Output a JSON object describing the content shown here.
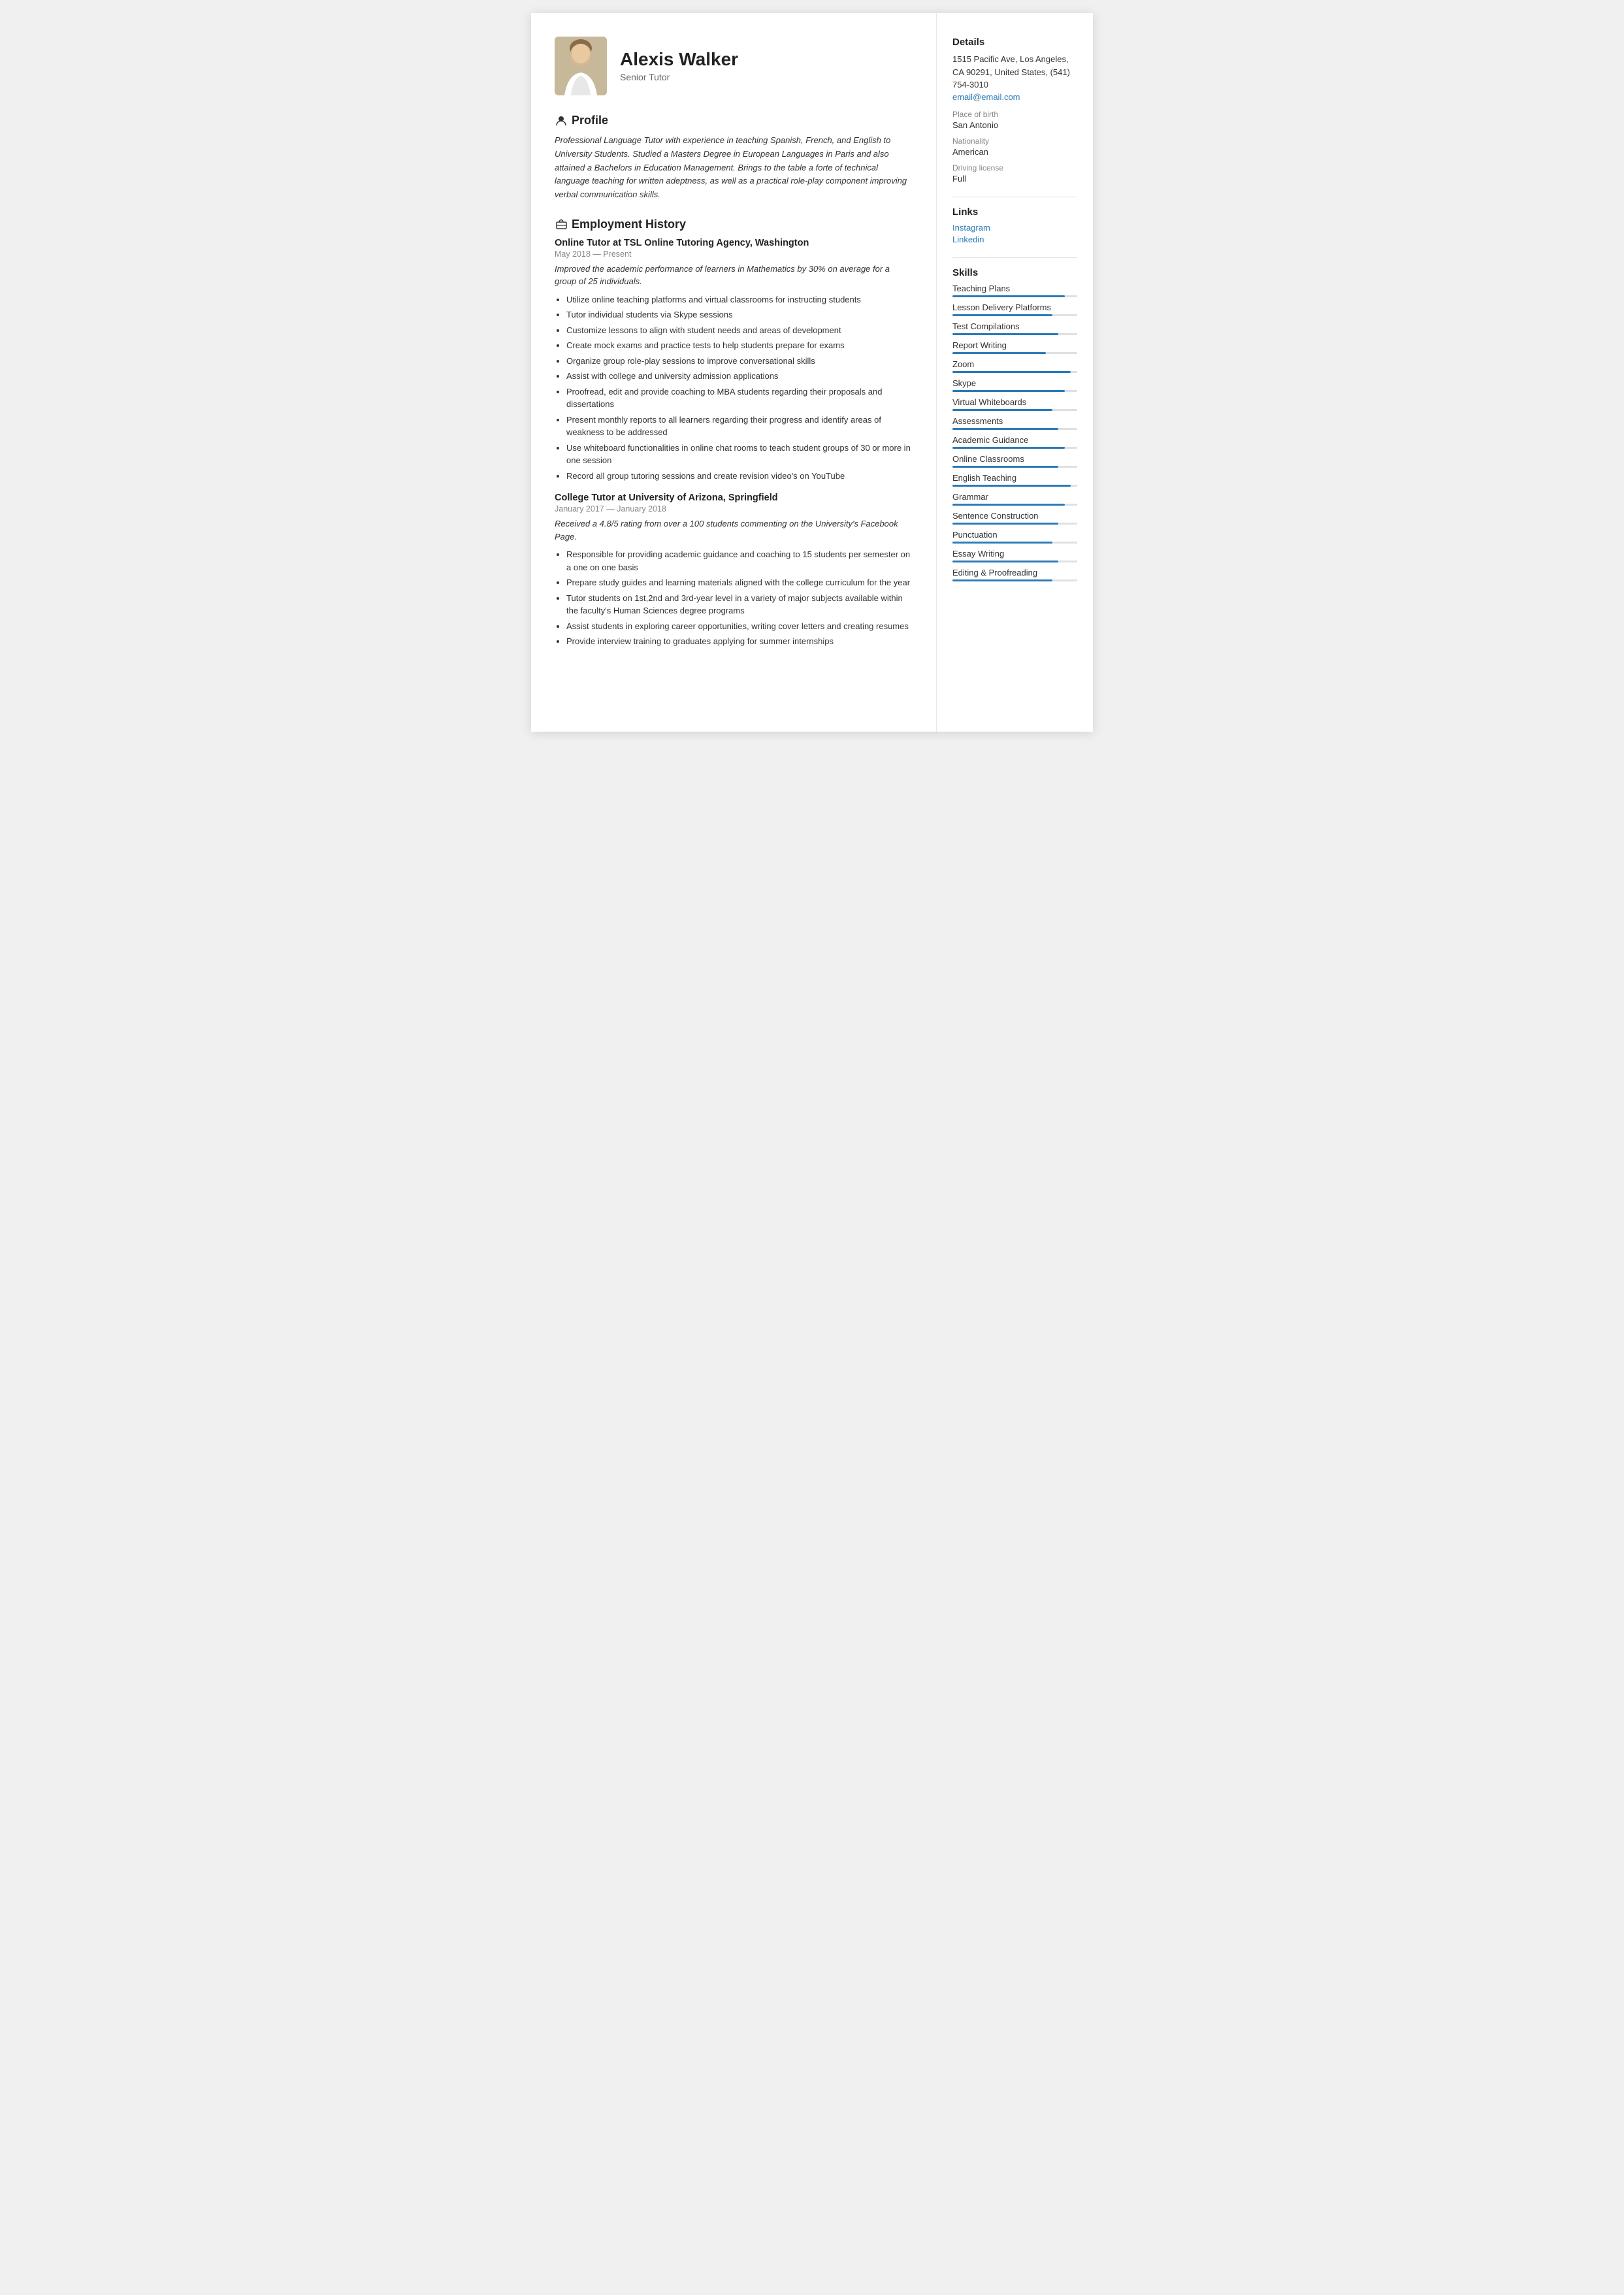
{
  "header": {
    "name": "Alexis Walker",
    "title": "Senior Tutor"
  },
  "profile": {
    "section_title": "Profile",
    "text": "Professional Language Tutor with experience in teaching Spanish, French, and English to University Students. Studied a Masters Degree in European Languages in Paris and also attained a Bachelors in Education Management. Brings to the table a forte of technical language teaching for written adeptness, as well as a practical role-play component improving verbal communication skills."
  },
  "employment": {
    "section_title": "Employment History",
    "jobs": [
      {
        "title": "Online Tutor at  TSL Online Tutoring Agency, Washington",
        "period": "May 2018 — Present",
        "summary": "Improved the academic performance of learners in Mathematics by 30% on average for a group of 25 individuals.",
        "bullets": [
          "Utilize online teaching platforms and virtual classrooms for instructing students",
          "Tutor individual students via Skype sessions",
          "Customize lessons to align with student needs and areas of development",
          "Create mock exams and practice tests to help students prepare for exams",
          "Organize group role-play sessions to improve conversational skills",
          "Assist with college and university admission applications",
          "Proofread, edit and provide coaching to MBA students regarding their proposals and dissertations",
          "Present monthly reports to all learners regarding their progress and identify areas of weakness to be addressed",
          "Use whiteboard functionalities in online chat rooms to teach student groups of 30 or more in one session",
          "Record all group tutoring sessions and create revision video's on YouTube"
        ]
      },
      {
        "title": "College Tutor at  University of Arizona, Springfield",
        "period": "January 2017 — January 2018",
        "summary": "Received a 4.8/5 rating from over a 100 students commenting on the University's Facebook Page.",
        "bullets": [
          "Responsible for providing academic guidance and coaching to 15 students per semester on a one on one basis",
          "Prepare study guides and learning materials aligned with the college curriculum for the year",
          "Tutor students on 1st,2nd and 3rd-year level in a variety of major subjects available within the faculty's Human Sciences degree programs",
          "Assist students in exploring career opportunities, writing cover letters and creating resumes",
          "Provide interview training to graduates applying for summer internships"
        ]
      }
    ]
  },
  "sidebar": {
    "details_title": "Details",
    "address": "1515 Pacific Ave, Los Angeles, CA 90291, United States, (541) 754-3010",
    "email": "email@email.com",
    "place_of_birth_label": "Place of birth",
    "place_of_birth": "San Antonio",
    "nationality_label": "Nationality",
    "nationality": "American",
    "driving_license_label": "Driving license",
    "driving_license": "Full",
    "links_title": "Links",
    "links": [
      {
        "label": "Instagram",
        "url": "#"
      },
      {
        "label": "Linkedin",
        "url": "#"
      }
    ],
    "skills_title": "Skills",
    "skills": [
      {
        "name": "Teaching Plans",
        "level": 90
      },
      {
        "name": "Lesson Delivery Platforms",
        "level": 80
      },
      {
        "name": "Test Compilations",
        "level": 85
      },
      {
        "name": "Report Writing",
        "level": 75
      },
      {
        "name": "Zoom",
        "level": 95
      },
      {
        "name": "Skype",
        "level": 90
      },
      {
        "name": "Virtual Whiteboards",
        "level": 80
      },
      {
        "name": "Assessments",
        "level": 85
      },
      {
        "name": "Academic Guidance",
        "level": 90
      },
      {
        "name": "Online Classrooms",
        "level": 85
      },
      {
        "name": "English Teaching",
        "level": 95
      },
      {
        "name": "Grammar",
        "level": 90
      },
      {
        "name": "Sentence Construction",
        "level": 85
      },
      {
        "name": "Punctuation",
        "level": 80
      },
      {
        "name": "Essay Writing",
        "level": 85
      },
      {
        "name": "Editing & Proofreading",
        "level": 80
      }
    ]
  }
}
